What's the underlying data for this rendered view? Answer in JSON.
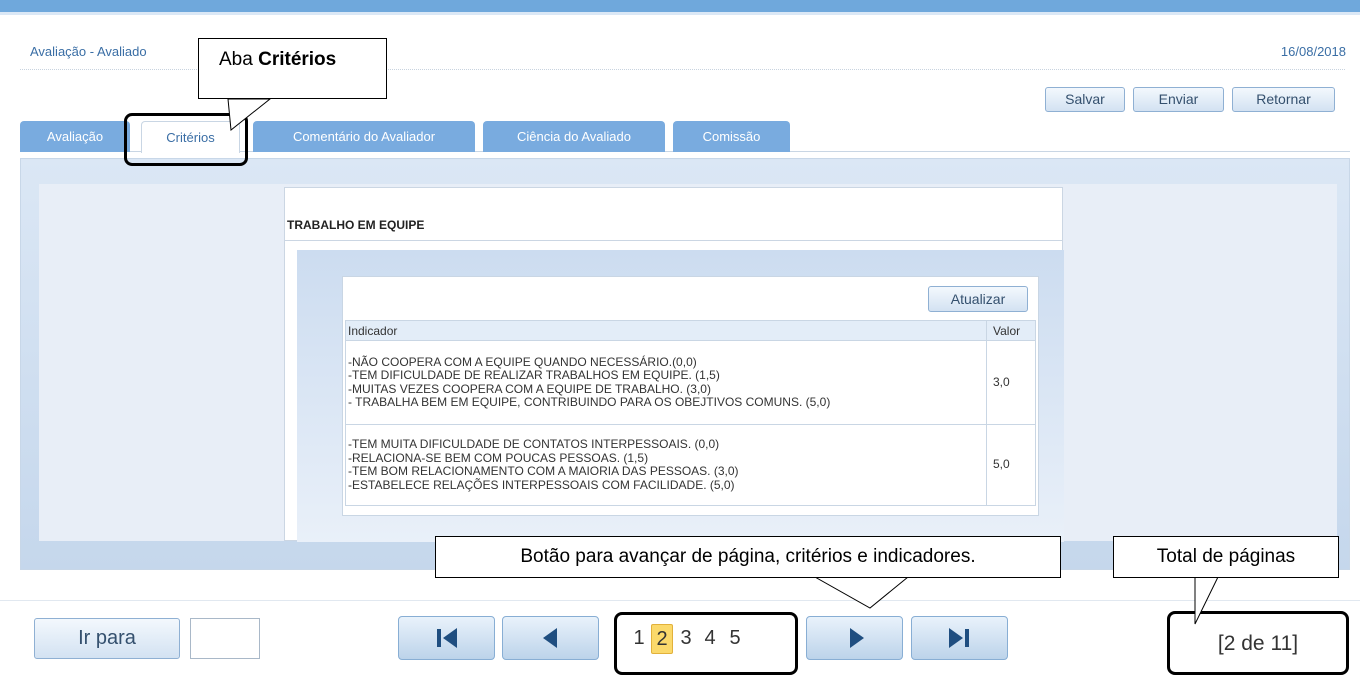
{
  "header": {
    "breadcrumb": "Avaliação - Avaliado",
    "date": "16/08/2018"
  },
  "toolbar": {
    "save_label": "Salvar",
    "send_label": "Enviar",
    "return_label": "Retornar"
  },
  "tabs": [
    {
      "label": "Avaliação",
      "active": false
    },
    {
      "label": "Critérios",
      "active": true
    },
    {
      "label": "Comentário do Avaliador",
      "active": false
    },
    {
      "label": "Ciência do Avaliado",
      "active": false
    },
    {
      "label": "Comissão",
      "active": false
    }
  ],
  "criterion": {
    "title": "TRABALHO EM EQUIPE",
    "update_label": "Atualizar",
    "columns": [
      "Indicador",
      "Valor"
    ],
    "rows": [
      {
        "indicators": [
          "-NÃO COOPERA COM A EQUIPE QUANDO NECESSÁRIO.(0,0)",
          "-TEM DIFICULDADE DE REALIZAR TRABALHOS EM EQUIPE. (1,5)",
          "-MUITAS VEZES COOPERA COM A EQUIPE DE TRABALHO. (3,0)",
          "- TRABALHA BEM EM EQUIPE, CONTRIBUINDO PARA OS OBEJTIVOS COMUNS. (5,0)"
        ],
        "value": "3,0"
      },
      {
        "indicators": [
          "-TEM MUITA DIFICULDADE DE CONTATOS INTERPESSOAIS. (0,0)",
          "-RELACIONA-SE BEM COM POUCAS PESSOAS. (1,5)",
          "-TEM BOM RELACIONAMENTO COM A MAIORIA DAS PESSOAS. (3,0)",
          "-ESTABELECE RELAÇÕES INTERPESSOAIS COM FACILIDADE. (5,0)"
        ],
        "value": "5,0"
      }
    ]
  },
  "pager": {
    "goto_label": "Ir para",
    "goto_value": "",
    "pages": [
      "1",
      "2",
      "3",
      "4",
      "5"
    ],
    "current_page": "2",
    "total": "[2 de 11]"
  },
  "callouts": {
    "tab_prefix": "Aba ",
    "tab_bold": "Critérios",
    "next_button": "Botão para avançar de página, critérios e indicadores.",
    "total_pages": "Total de páginas"
  },
  "colors": {
    "accent": "#6fa8dc",
    "tab": "#79abdf",
    "current_page": "#fbd96b",
    "icon": "#1f4e80"
  },
  "icons": {
    "first": "first-page-icon",
    "prev": "previous-page-icon",
    "next": "next-page-icon",
    "last": "last-page-icon"
  }
}
